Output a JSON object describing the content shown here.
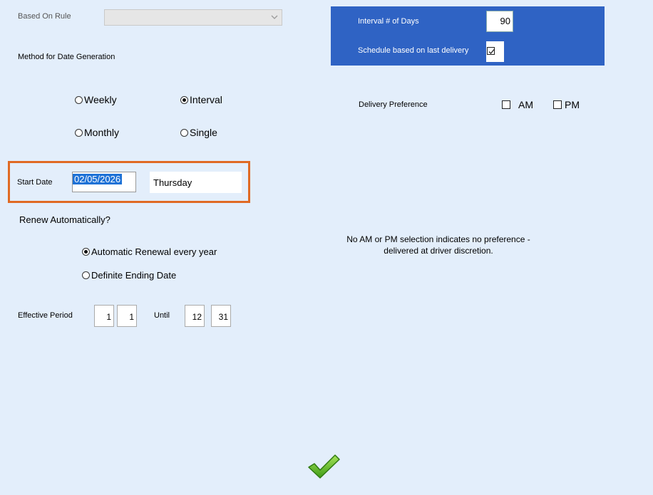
{
  "based_on_rule": {
    "label": "Based On Rule",
    "value": ""
  },
  "method": {
    "label": "Method for Date Generation",
    "options": [
      {
        "label": "Weekly",
        "selected": false
      },
      {
        "label": "Interval",
        "selected": true
      },
      {
        "label": "Monthly",
        "selected": false
      },
      {
        "label": "Single",
        "selected": false
      }
    ]
  },
  "interval_panel": {
    "days_label": "Interval # of Days",
    "days_value": "90",
    "schedule_label": "Schedule based on last delivery",
    "schedule_checked": true,
    "bg_color": "#2f63c4"
  },
  "delivery": {
    "label": "Delivery Preference",
    "am_label": "AM",
    "pm_label": "PM",
    "note_line1": "No AM or PM selection indicates no preference -",
    "note_line2": "delivered at driver discretion."
  },
  "start_date": {
    "label": "Start Date",
    "value": "02/05/2026",
    "day": "Thursday",
    "highlight_color": "#e06a24"
  },
  "renew": {
    "label": "Renew Automatically?",
    "options": [
      {
        "label": "Automatic Renewal every year",
        "selected": true
      },
      {
        "label": "Definite Ending Date",
        "selected": false
      }
    ]
  },
  "effective": {
    "label": "Effective Period",
    "from_month": "1",
    "from_day": "1",
    "until_label": "Until",
    "to_month": "12",
    "to_day": "31"
  },
  "confirm": {
    "icon": "checkmark-icon",
    "color": "#5cc02a"
  }
}
